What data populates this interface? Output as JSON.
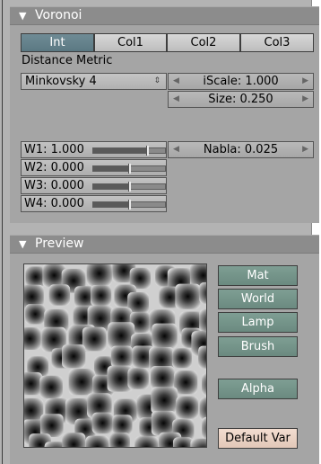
{
  "voronoi": {
    "title": "Voronoi",
    "tabs": [
      {
        "label": "Int",
        "active": true
      },
      {
        "label": "Col1",
        "active": false
      },
      {
        "label": "Col2",
        "active": false
      },
      {
        "label": "Col3",
        "active": false
      }
    ],
    "distance_metric_label": "Distance Metric",
    "distance_metric_value": "Minkovsky 4",
    "iscale": "iScale: 1.000",
    "size": "Size: 0.250",
    "nabla": "Nabla: 0.025",
    "weights": [
      {
        "label": "W1: 1.000",
        "value": 1.0
      },
      {
        "label": "W2: 0.000",
        "value": 0.0
      },
      {
        "label": "W3: 0.000",
        "value": 0.0
      },
      {
        "label": "W4: 0.000",
        "value": 0.0
      }
    ]
  },
  "preview": {
    "title": "Preview",
    "buttons": [
      "Mat",
      "World",
      "Lamp",
      "Brush"
    ],
    "alpha_label": "Alpha",
    "default_var_label": "Default Var"
  },
  "colors": {
    "active_tab": "#5f7d87",
    "preview_buttons": "#7a9a8f",
    "default_var": "#ead2c3"
  }
}
